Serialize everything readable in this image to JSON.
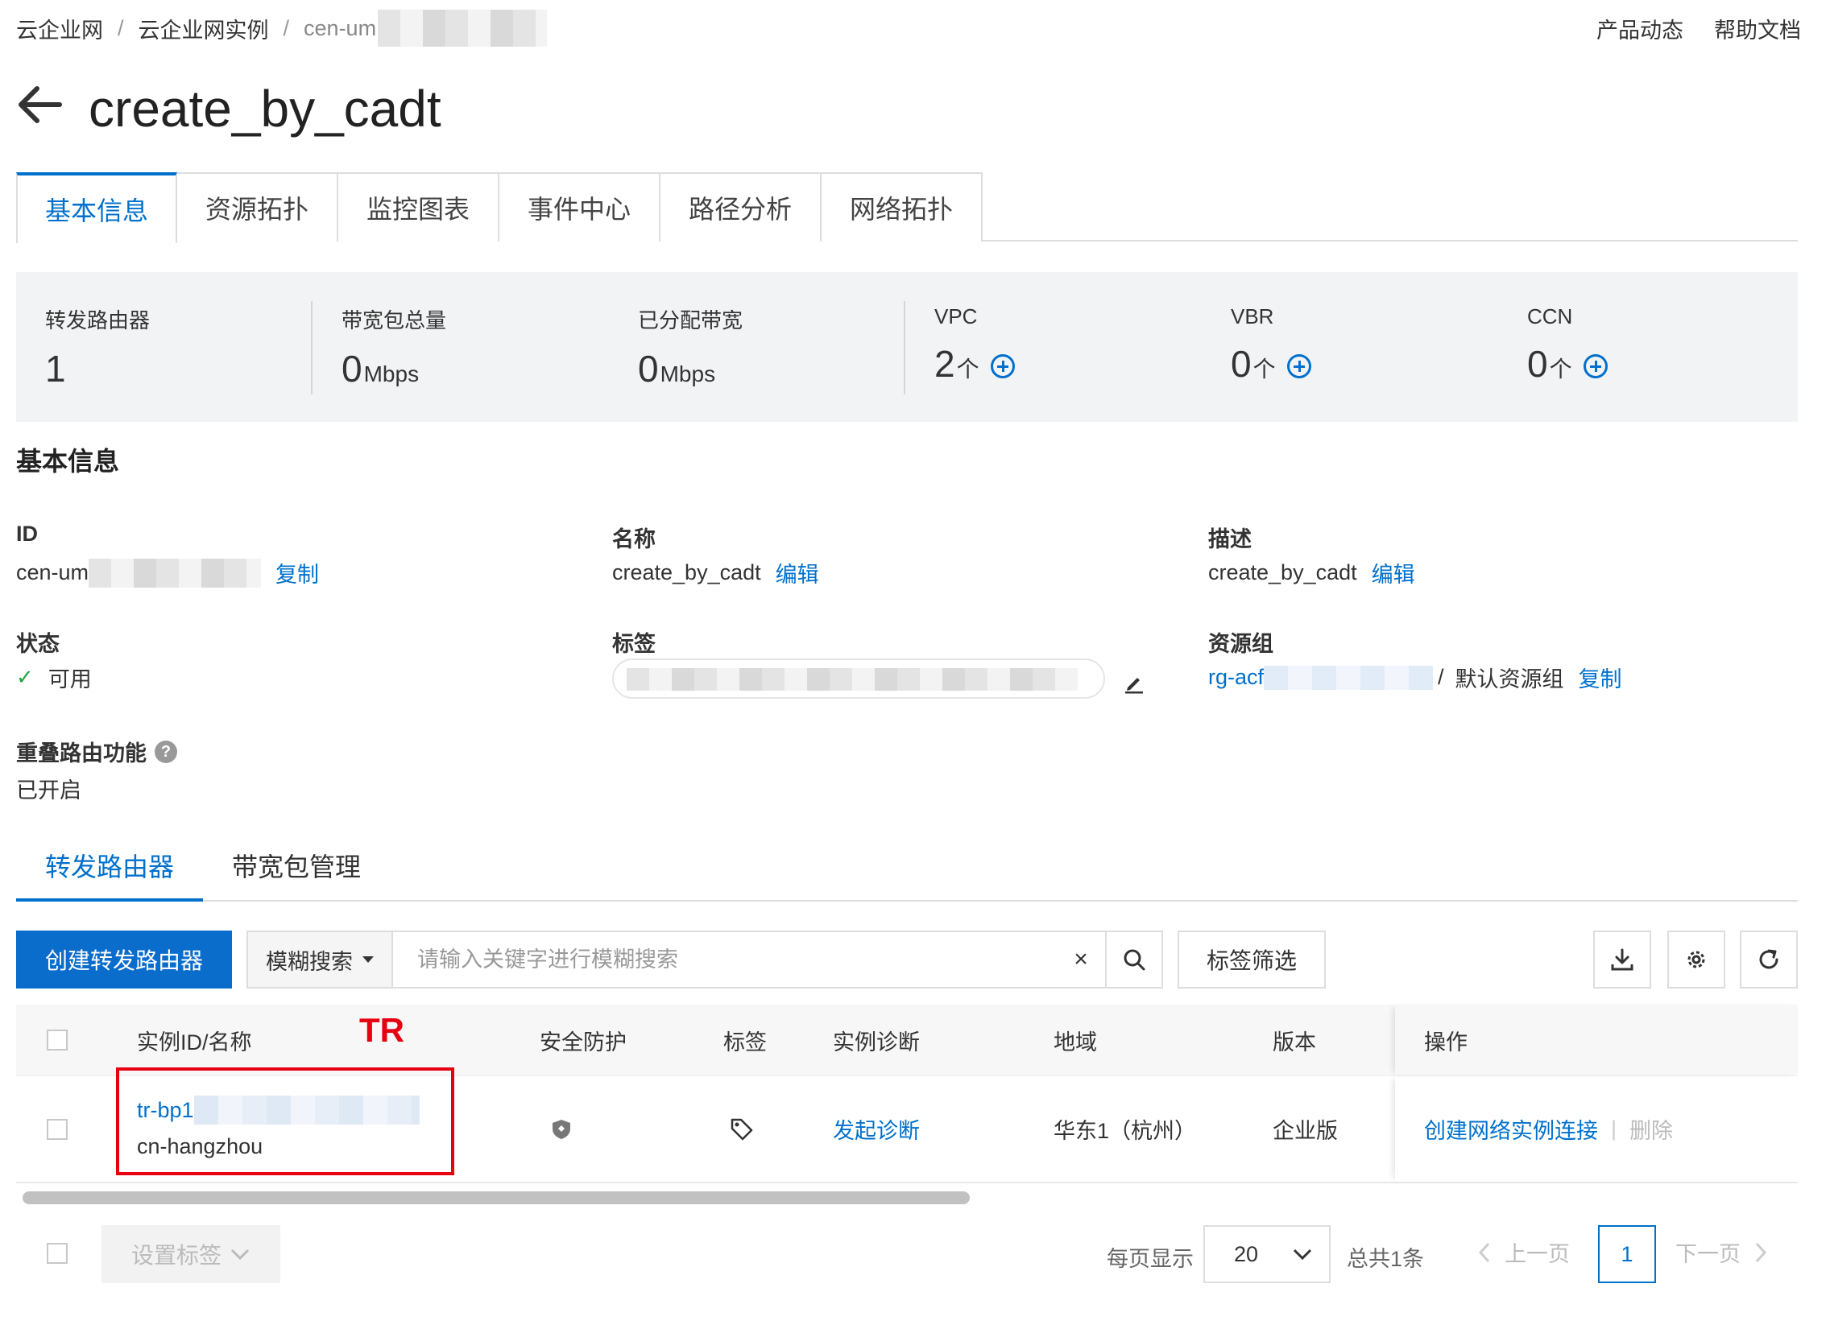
{
  "breadcrumb": {
    "item1": "云企业网",
    "item2": "云企业网实例",
    "item3": "cen-um"
  },
  "top_links": {
    "product_news": "产品动态",
    "help_docs": "帮助文档"
  },
  "title": "create_by_cadt",
  "main_tabs": [
    "基本信息",
    "资源拓扑",
    "监控图表",
    "事件中心",
    "路径分析",
    "网络拓扑"
  ],
  "stats": [
    {
      "label": "转发路由器",
      "value": "1",
      "unit": ""
    },
    {
      "label": "带宽包总量",
      "value": "0",
      "unit": "Mbps"
    },
    {
      "label": "已分配带宽",
      "value": "0",
      "unit": "Mbps"
    },
    {
      "label": "VPC",
      "value": "2",
      "unit": "个"
    },
    {
      "label": "VBR",
      "value": "0",
      "unit": "个"
    },
    {
      "label": "CCN",
      "value": "0",
      "unit": "个"
    }
  ],
  "basic_info": {
    "section_title": "基本信息",
    "id_label": "ID",
    "id_value": "cen-um",
    "copy": "复制",
    "name_label": "名称",
    "name_value": "create_by_cadt",
    "edit": "编辑",
    "desc_label": "描述",
    "desc_value": "create_by_cadt",
    "status_label": "状态",
    "status_value": "可用",
    "tag_label": "标签",
    "rg_label": "资源组",
    "rg_value": "rg-acf",
    "rg_sep": "/",
    "rg_default": "默认资源组",
    "overlap_label": "重叠路由功能",
    "overlap_value": "已开启"
  },
  "sub_tabs": [
    "转发路由器",
    "带宽包管理"
  ],
  "toolbar": {
    "create": "创建转发路由器",
    "search_mode": "模糊搜索",
    "search_placeholder": "请输入关键字进行模糊搜索",
    "clear": "×",
    "tag_filter": "标签筛选"
  },
  "table": {
    "headers": {
      "id": "实例ID/名称",
      "security": "安全防护",
      "tag": "标签",
      "diag": "实例诊断",
      "region": "地域",
      "version": "版本",
      "ops": "操作"
    },
    "row": {
      "id": "tr-bp1",
      "name": "cn-hangzhou",
      "diag": "发起诊断",
      "region": "华东1（杭州）",
      "version": "企业版",
      "op_create": "创建网络实例连接",
      "op_sep": "|",
      "op_delete": "删除"
    }
  },
  "annotation": {
    "label": "TR",
    "color": "#e60012"
  },
  "footer": {
    "set_tag": "设置标签",
    "per_page_label": "每页显示",
    "per_page": "20",
    "total": "总共1条",
    "prev": "上一页",
    "current": "1",
    "next": "下一页"
  },
  "colors": {
    "accent": "#0070cc",
    "success": "#22a447"
  }
}
